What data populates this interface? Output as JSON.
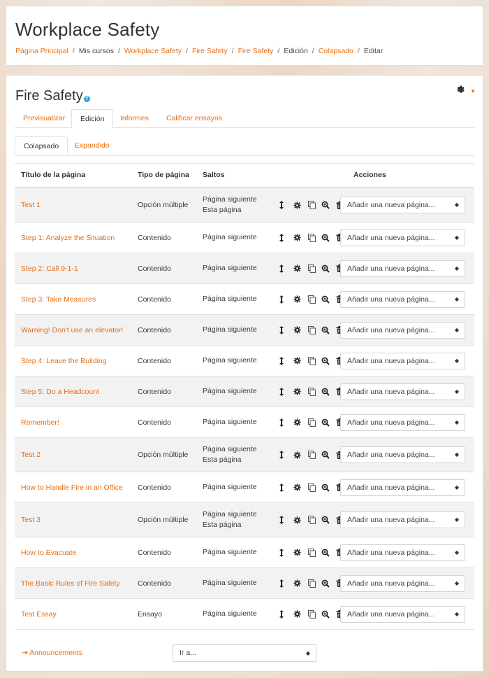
{
  "header": {
    "title": "Workplace Safety",
    "breadcrumbs": [
      {
        "label": "Página Principal",
        "link": true
      },
      {
        "label": "Mis cursos",
        "link": false
      },
      {
        "label": "Workplace Safety",
        "link": true
      },
      {
        "label": "Fire Safety",
        "link": true
      },
      {
        "label": "Fire Safety",
        "link": true
      },
      {
        "label": "Edición",
        "link": false
      },
      {
        "label": "Colapsado",
        "link": true
      },
      {
        "label": "Editar",
        "link": false
      }
    ],
    "separator": "/"
  },
  "page": {
    "title": "Fire Safety",
    "help_glyph": "?",
    "settings_icon": "gear-icon"
  },
  "tabs": [
    {
      "label": "Previsualizar",
      "active": false
    },
    {
      "label": "Edición",
      "active": true
    },
    {
      "label": "Informes",
      "active": false
    },
    {
      "label": "Calificar ensayos",
      "active": false
    }
  ],
  "subtabs": [
    {
      "label": "Colapsado",
      "active": true
    },
    {
      "label": "Expandido",
      "active": false
    }
  ],
  "table": {
    "headers": {
      "title": "Título de la página",
      "type": "Tipo de página",
      "jumps": "Saltos",
      "actions": "Acciones"
    },
    "action_icons": [
      "move-icon",
      "gear-icon",
      "copy-icon",
      "preview-icon",
      "trash-icon"
    ],
    "add_page_placeholder": "Añadir una nueva página...",
    "rows": [
      {
        "title": "Test 1",
        "type": "Opción múltiple",
        "jumps": [
          "Página siguiente",
          "Esta página"
        ]
      },
      {
        "title": "Step 1: Analyze the Situation",
        "type": "Contenido",
        "jumps": [
          "Página siguiente"
        ]
      },
      {
        "title": "Step 2: Call 9-1-1",
        "type": "Contenido",
        "jumps": [
          "Página siguiente"
        ]
      },
      {
        "title": "Step 3: Take Measures",
        "type": "Contenido",
        "jumps": [
          "Página siguiente"
        ]
      },
      {
        "title": "Warning! Don't use an elevator!",
        "type": "Contenido",
        "jumps": [
          "Página siguiente"
        ]
      },
      {
        "title": "Step 4: Leave the Building",
        "type": "Contenido",
        "jumps": [
          "Página siguiente"
        ]
      },
      {
        "title": "Step 5: Do a Headcount",
        "type": "Contenido",
        "jumps": [
          "Página siguiente"
        ]
      },
      {
        "title": "Remember!",
        "type": "Contenido",
        "jumps": [
          "Página siguiente"
        ]
      },
      {
        "title": "Test 2",
        "type": "Opción múltiple",
        "jumps": [
          "Página siguiente",
          "Esta página"
        ]
      },
      {
        "title": "How to Handle Fire in an Office",
        "type": "Contenido",
        "jumps": [
          "Página siguiente"
        ]
      },
      {
        "title": "Test 3",
        "type": "Opción múltiple",
        "jumps": [
          "Página siguiente",
          "Esta página"
        ]
      },
      {
        "title": "How to Evacuate",
        "type": "Contenido",
        "jumps": [
          "Página siguiente"
        ]
      },
      {
        "title": "The Basic Rules of Fire Safety",
        "type": "Contenido",
        "jumps": [
          "Página siguiente"
        ]
      },
      {
        "title": "Test Essay",
        "type": "Ensayo",
        "jumps": [
          "Página siguiente"
        ]
      }
    ]
  },
  "footer": {
    "prev_link_arrow": "⇥",
    "prev_link": "Announcements",
    "jump_to": "Ir a..."
  },
  "colors": {
    "accent": "#e46f18",
    "help": "#2fa4e7",
    "row_stripe": "#f2f2f2"
  }
}
